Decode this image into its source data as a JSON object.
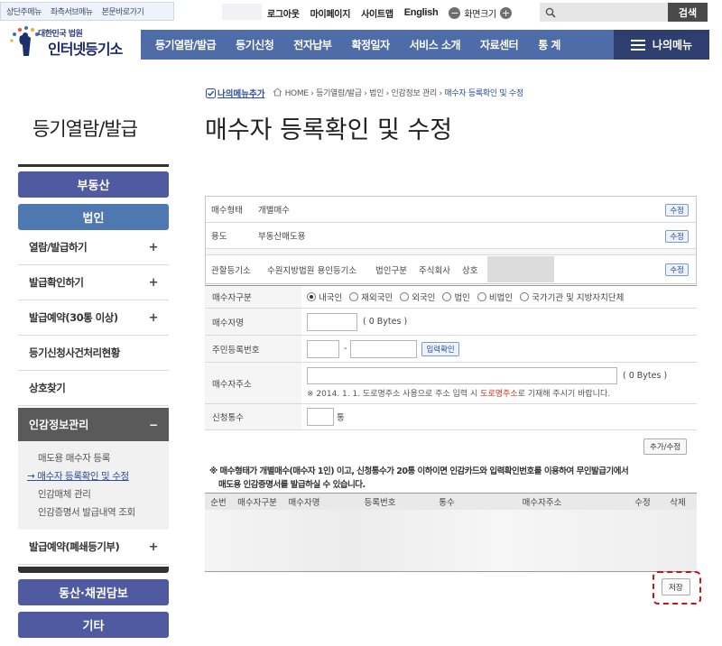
{
  "top_bar": {
    "skip_links": [
      "상단주메뉴",
      "좌측서브메뉴",
      "본문바로가기"
    ],
    "util_links": [
      "로그아웃",
      "마이페이지",
      "사이트맵"
    ],
    "english": "English",
    "zoom_label": "화면크기",
    "zoom_minus": "−",
    "zoom_plus": "+",
    "search_placeholder": "",
    "search_button": "검색"
  },
  "logo": {
    "top": "대한민국 법원",
    "main": "인터넷등기소"
  },
  "gnb": [
    "등기열람/발급",
    "등기신청",
    "전자납부",
    "확정일자",
    "서비스 소개",
    "자료센터",
    "통 계"
  ],
  "my_menu": "나의메뉴",
  "sidebar": {
    "title": "등기열람/발급",
    "btn_real_estate": "부동산",
    "btn_corporation": "법인",
    "items": [
      {
        "label": "열람/발급하기",
        "plus": "+"
      },
      {
        "label": "발급확인하기",
        "plus": "+"
      },
      {
        "label": "발급예약(30통 이상)",
        "plus": "+"
      },
      {
        "label": "등기신청사건처리현황",
        "plus": ""
      },
      {
        "label": "상호찾기",
        "plus": ""
      }
    ],
    "active": {
      "label": "인감정보관리",
      "minus": "−"
    },
    "subitems": [
      "매도용 매수자 등록",
      "→ 매수자 등록확인 및 수정",
      "인감매체 관리",
      "인감증명서 발급내역 조회"
    ],
    "after_items": [
      {
        "label": "발급예약(폐쇄등기부)",
        "plus": "+"
      }
    ],
    "btn_movable": "동산·채권담보",
    "btn_other": "기타"
  },
  "breadcrumb": {
    "add_my_menu": "나의메뉴추가",
    "path": "HOME › 등기열람/발급 › 법인 › 인감정보 관리 ›",
    "current": "매수자 등록확인 및 수정"
  },
  "page_title": "매수자 등록확인 및 수정",
  "info": {
    "rows": [
      {
        "label": "매수형태",
        "value": "개별매수",
        "btn": "수정"
      },
      {
        "label": "용도",
        "value": "부동산매도용",
        "btn": "수정"
      }
    ],
    "registry_label": "관할등기소",
    "registry_value": "수원지방법원 용인등기소",
    "corp_type_label": "법인구분",
    "corp_type_value": "주식회사",
    "name_label": "상호",
    "registry_btn": "수정"
  },
  "form": {
    "buyer_type_label": "매수자구분",
    "buyer_types": [
      "내국인",
      "재외국민",
      "외국인",
      "법인",
      "비법인",
      "국가기관 및 지방자치단체"
    ],
    "buyer_name_label": "매수자명",
    "buyer_name_bytes": "( 0  Bytes )",
    "id_label": "주민등록번호",
    "id_dash": "-",
    "id_btn": "입력확인",
    "address_label": "매수자주소",
    "address_bytes": "( 0  Bytes )",
    "address_note_prefix": "※ 2014. 1. 1. 도로명주소 사용으로 주소 입력 시",
    "address_note_emph": "도로명주소",
    "address_note_suffix": "로 기재해 주시기 바랍니다.",
    "count_label": "신청통수",
    "count_unit": "통",
    "add_modify_btn": "추가/수정"
  },
  "note": {
    "line1": "※ 매수형태가 개별매수(매수자 1인) 이고, 신청통수가 20통 이하이면 인감카드와 입력확인번호를 이용하여 무인발급기에서",
    "line2": "매도용 인감증명서를 발급하실 수 있습니다."
  },
  "list": {
    "headers": [
      "순번",
      "매수자구분",
      "매수자명",
      "등록번호",
      "통수",
      "매수자주소",
      "수정",
      "삭제"
    ]
  },
  "save_button": "저장",
  "colors": {
    "gnb": "#4e6ca8",
    "mymenu": "#2e3f6f",
    "side_btn": "#4f5aa0",
    "highlight": "#cc1111"
  }
}
